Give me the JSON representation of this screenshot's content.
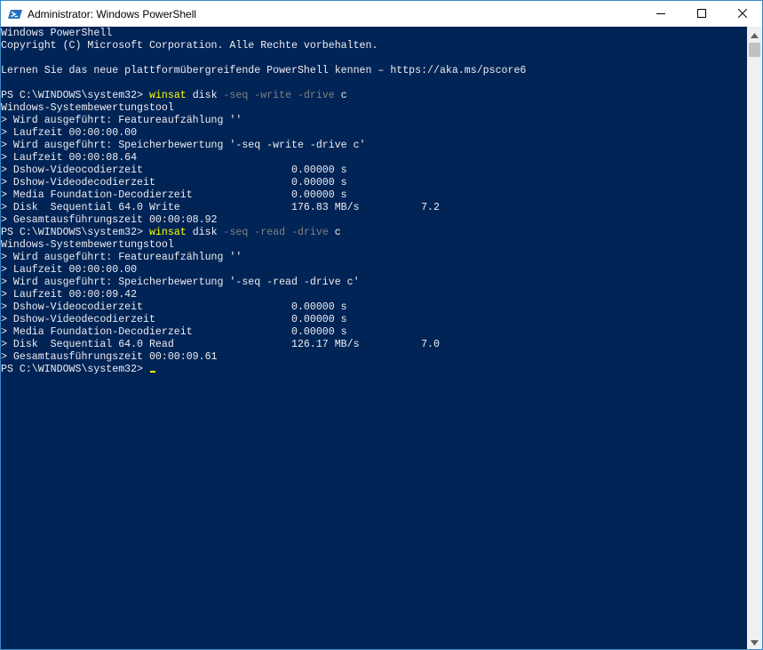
{
  "window": {
    "title": "Administrator: Windows PowerShell",
    "colors": {
      "terminal_background": "#012456",
      "text": "#eeedf0",
      "command": "#ffff00",
      "parameter": "#808080",
      "titlebar": "#ffffff",
      "border": "#3a86c8"
    },
    "icons": {
      "app": "powershell-icon",
      "minimize": "minimize-icon",
      "maximize": "maximize-icon",
      "close": "close-icon"
    }
  },
  "console": {
    "lines": [
      "Windows PowerShell",
      "Copyright (C) Microsoft Corporation. Alle Rechte vorbehalten.",
      "",
      "Lernen Sie das neue plattformübergreifende PowerShell kennen – https://aka.ms/pscore6",
      "",
      {
        "prompt": "PS C:\\WINDOWS\\system32> ",
        "cmd": "winsat",
        "parts": [
          [
            " disk ",
            "text"
          ],
          [
            "-seq",
            "param"
          ],
          [
            " ",
            "text"
          ],
          [
            "-write",
            "param"
          ],
          [
            " ",
            "text"
          ],
          [
            "-drive",
            "param"
          ],
          [
            " c",
            "text"
          ]
        ]
      },
      "Windows-Systembewertungstool",
      "> Wird ausgeführt: Featureaufzählung ''",
      "> Laufzeit 00:00:00.00",
      "> Wird ausgeführt: Speicherbewertung '-seq -write -drive c'",
      "> Laufzeit 00:00:08.64",
      "> Dshow-Videocodierzeit                        0.00000 s",
      "> Dshow-Videodecodierzeit                      0.00000 s",
      "> Media Foundation-Decodierzeit                0.00000 s",
      "> Disk  Sequential 64.0 Write                  176.83 MB/s          7.2",
      "> Gesamtausführungszeit 00:00:08.92",
      {
        "prompt": "PS C:\\WINDOWS\\system32> ",
        "cmd": "winsat",
        "parts": [
          [
            " disk ",
            "text"
          ],
          [
            "-seq",
            "param"
          ],
          [
            " ",
            "text"
          ],
          [
            "-read",
            "param"
          ],
          [
            " ",
            "text"
          ],
          [
            "-drive",
            "param"
          ],
          [
            " c",
            "text"
          ]
        ]
      },
      "Windows-Systembewertungstool",
      "> Wird ausgeführt: Featureaufzählung ''",
      "> Laufzeit 00:00:00.00",
      "> Wird ausgeführt: Speicherbewertung '-seq -read -drive c'",
      "> Laufzeit 00:00:09.42",
      "> Dshow-Videocodierzeit                        0.00000 s",
      "> Dshow-Videodecodierzeit                      0.00000 s",
      "> Media Foundation-Decodierzeit                0.00000 s",
      "> Disk  Sequential 64.0 Read                   126.17 MB/s          7.0",
      "> Gesamtausführungszeit 00:00:09.61",
      {
        "prompt": "PS C:\\WINDOWS\\system32> ",
        "cursor": true
      }
    ]
  }
}
